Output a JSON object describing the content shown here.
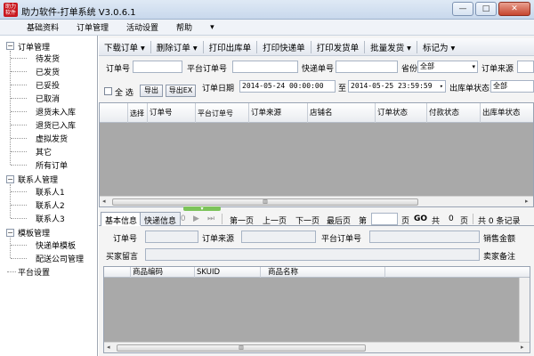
{
  "window": {
    "logo_text": "助力\n软件",
    "title": "助力软件-打单系统 V3.0.6.1",
    "minimize": "—",
    "maximize": "□",
    "close": "✕"
  },
  "menu": [
    "基础资料",
    "订单管理",
    "活动设置",
    "帮助",
    "▾"
  ],
  "sidebar": {
    "groups": [
      {
        "label": "订单管理",
        "toggle": "−",
        "children": [
          "待发货",
          "已发货",
          "已妥投",
          "已取消",
          "退货未入库",
          "退货已入库",
          "虚拟发货",
          "其它",
          "所有订单"
        ]
      },
      {
        "label": "联系人管理",
        "toggle": "−",
        "children": [
          "联系人1",
          "联系人2",
          "联系人3"
        ]
      },
      {
        "label": "模板管理",
        "toggle": "−",
        "children": [
          "快递单模板",
          "配送公司管理"
        ]
      }
    ],
    "platform": "平台设置"
  },
  "toolbar": [
    "下载订单 ▾",
    "删除订单 ▾",
    "打印出库单",
    "打印快递单",
    "打印发货单",
    "批量发货 ▾",
    "标记为 ▾"
  ],
  "filters": {
    "order_no_label": "订单号",
    "platform_order_label": "平台订单号",
    "express_no_label": "快递单号",
    "province_label": "省份",
    "province_value": "全部",
    "source_label": "订单来源",
    "select_all_label": "全 选",
    "export_btn": "导出",
    "export_ex_btn": "导出EX",
    "order_date_label": "订单日期",
    "date_from": "2014-05-24 00:00:00",
    "date_to_label": "至",
    "date_to": "2014-05-25 23:59:59",
    "outbound_status_label": "出库单状态",
    "outbound_status_value": "全部",
    "arrow": "▾"
  },
  "grid": {
    "columns": [
      "选择",
      "订单号",
      "平台订单号",
      "订单来源",
      "店铺名",
      "订单状态",
      "付款状态",
      "出库单状态"
    ],
    "scroll_thumb": "▥",
    "scroll_left": "◂",
    "scroll_right": "▸"
  },
  "pager": {
    "first_icon": "⏮",
    "prev_icon": "◀",
    "page_value": "0",
    "page_total": "/ 0",
    "next_icon": "▶",
    "last_icon": "⏭",
    "first_page": "第一页",
    "prev_page": "上一页",
    "next_page": "下一页",
    "last_page": "最后页",
    "goto_prefix": "第",
    "goto_suffix": "页",
    "go": "GO",
    "total_prefix": "共",
    "total_pages": "0",
    "total_pages_suffix": "页",
    "total_records": "共 0 条记录"
  },
  "splitter_icon": "▾",
  "tabs": [
    "基本信息",
    "快递信息"
  ],
  "detail": {
    "order_no_label": "订单号",
    "order_source_label": "订单来源",
    "platform_order_label": "平台订单号",
    "sales_amount_label": "销售金额",
    "buyer_msg_label": "买家留言",
    "seller_note_label": "卖家备注",
    "columns": [
      "商品编码",
      "SKUID",
      "商品名称"
    ]
  }
}
